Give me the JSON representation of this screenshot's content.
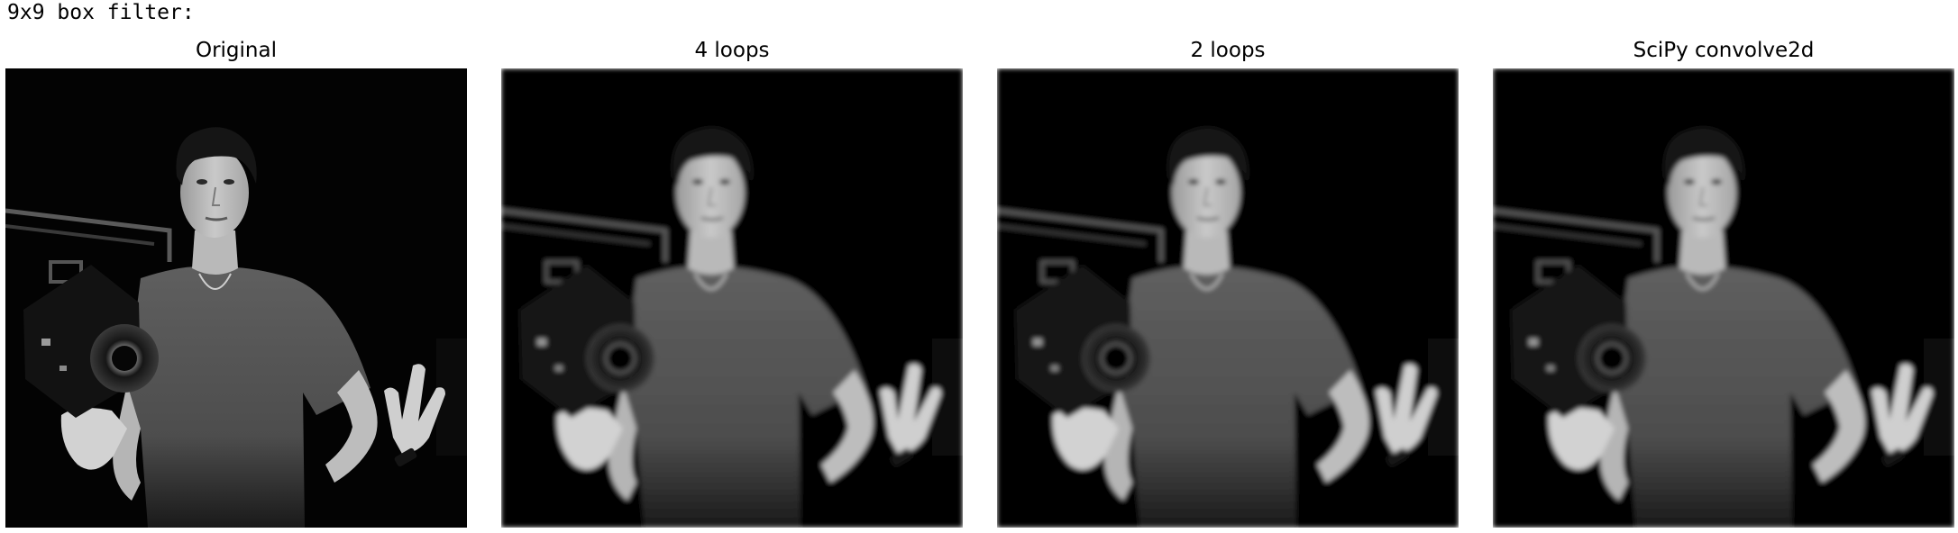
{
  "header": {
    "text": "9x9 box filter:"
  },
  "panels": [
    {
      "title": "Original",
      "blur": 0
    },
    {
      "title": "4 loops",
      "blur": 2.6
    },
    {
      "title": "2 loops",
      "blur": 2.6
    },
    {
      "title": "SciPy convolve2d",
      "blur": 2.6
    }
  ],
  "image_content": {
    "description_color_scheme": "grayscale",
    "background": "#000000"
  }
}
